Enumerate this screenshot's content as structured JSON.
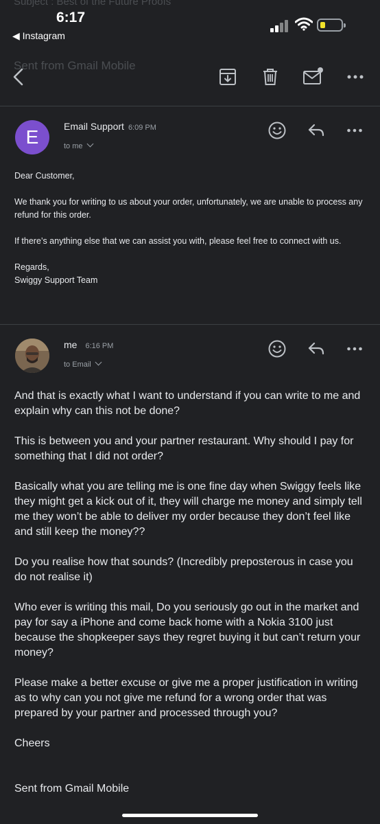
{
  "background_ghost": {
    "top_text": "Subject : Best of the Future Proofs",
    "mid_text": "Sent from Gmail Mobile"
  },
  "status_bar": {
    "time": "6:17",
    "back_label": "◀ Instagram"
  },
  "colors": {
    "background": "#202124",
    "avatar_e": "#7b4fce",
    "battery_fill": "#f2e22a"
  },
  "toolbar": {
    "icons": [
      "back-arrow-icon",
      "archive-icon",
      "trash-icon",
      "mark-unread-icon",
      "more-icon"
    ]
  },
  "messages": [
    {
      "avatar_letter": "E",
      "sender": "Email Support",
      "time": "6:09 PM",
      "recipient": "to me",
      "paragraphs": [
        "Dear Customer,",
        "We thank you for writing to us about your order, unfortunately, we are unable to process any refund for this order.",
        "If there’s anything else that we can assist you with, please feel free to connect with us."
      ],
      "signoff": "Regards,",
      "signature": "Swiggy Support Team"
    },
    {
      "sender": "me",
      "time": "6:16 PM",
      "recipient": "to Email",
      "paragraphs": [
        "And that is exactly what I want to understand if you can write to me and explain why can this not be done?",
        "This is between you and your partner restaurant. Why should I pay for something that I did not order?",
        "Basically what you are telling me is one fine day when Swiggy feels like they might get a kick out of it, they will charge me money and simply tell me they won’t be able to deliver my order because they don’t feel like and still keep the money??",
        "Do you realise how that sounds? (Incredibly preposterous in case you do not realise it)",
        "Who ever is writing this mail, Do you seriously go out in the market and pay for say a iPhone and come back home with a Nokia 3100 just because the shopkeeper says they regret buying it but can’t return your money?",
        "Please make a better excuse or give me a proper justification in writing as to why can you not give me refund for a wrong order that was prepared by your partner and processed through you?",
        "Cheers"
      ],
      "footer": "Sent from Gmail Mobile"
    }
  ]
}
